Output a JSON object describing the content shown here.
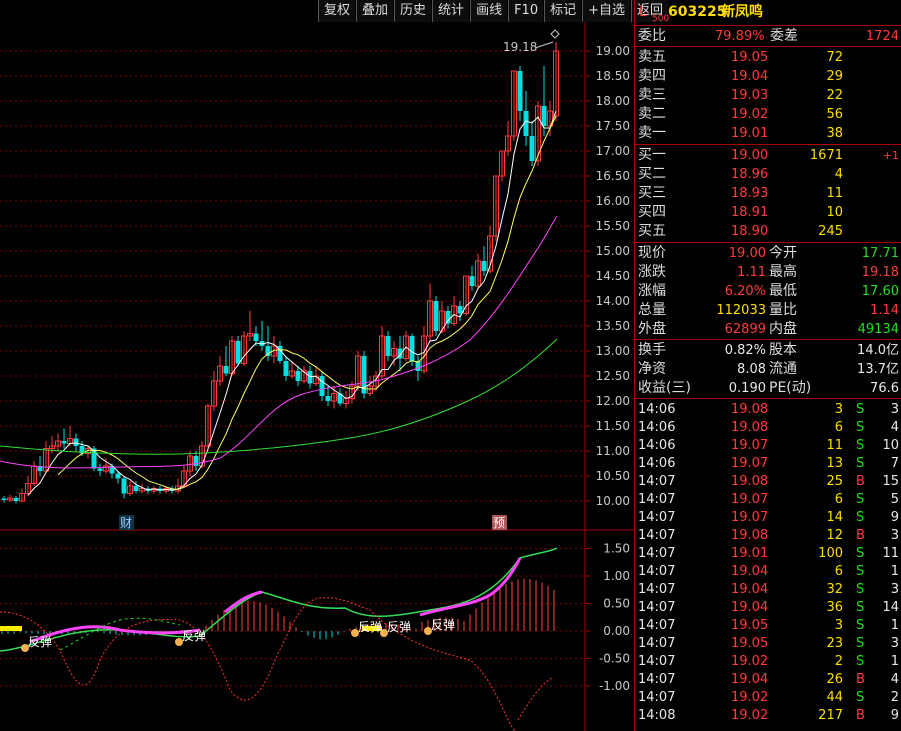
{
  "toolbar": [
    "复权",
    "叠加",
    "历史",
    "统计",
    "画线",
    "F10",
    "标记",
    "+自选",
    "返回"
  ],
  "stock": {
    "code_prefix": "L",
    "code_sub": "500",
    "code": "603225",
    "name": "新凤鸣"
  },
  "price_axis": [
    "19.00",
    "18.50",
    "18.00",
    "17.50",
    "17.00",
    "16.50",
    "16.00",
    "15.50",
    "15.00",
    "14.50",
    "14.00",
    "13.50",
    "13.00",
    "12.50",
    "12.00",
    "11.50",
    "11.00",
    "10.50",
    "10.00"
  ],
  "macd_axis": [
    "1.50",
    "1.00",
    "0.50",
    "0.00",
    "-0.50",
    "-1.00"
  ],
  "high_label": "19.18",
  "markers": {
    "cai": "财",
    "yu": "预"
  },
  "signal_label": "反弹",
  "weibi": {
    "label1": "委比",
    "val1": "79.89%",
    "label2": "委差",
    "val2": "1724"
  },
  "asks": [
    {
      "label": "卖五",
      "price": "19.05",
      "vol": "72"
    },
    {
      "label": "卖四",
      "price": "19.04",
      "vol": "29"
    },
    {
      "label": "卖三",
      "price": "19.03",
      "vol": "22"
    },
    {
      "label": "卖二",
      "price": "19.02",
      "vol": "56"
    },
    {
      "label": "卖一",
      "price": "19.01",
      "vol": "38"
    }
  ],
  "bids": [
    {
      "label": "买一",
      "price": "19.00",
      "vol": "1671",
      "chg": "+1"
    },
    {
      "label": "买二",
      "price": "18.96",
      "vol": "4",
      "chg": ""
    },
    {
      "label": "买三",
      "price": "18.93",
      "vol": "11",
      "chg": ""
    },
    {
      "label": "买四",
      "price": "18.91",
      "vol": "10",
      "chg": ""
    },
    {
      "label": "买五",
      "price": "18.90",
      "vol": "245",
      "chg": ""
    }
  ],
  "quote": [
    {
      "l1": "现价",
      "v1": "19.00",
      "c1": "red",
      "l2": "今开",
      "v2": "17.71",
      "c2": "grn"
    },
    {
      "l1": "涨跌",
      "v1": "1.11",
      "c1": "red",
      "l2": "最高",
      "v2": "19.18",
      "c2": "red"
    },
    {
      "l1": "涨幅",
      "v1": "6.20%",
      "c1": "red",
      "l2": "最低",
      "v2": "17.60",
      "c2": "grn"
    },
    {
      "l1": "总量",
      "v1": "112033",
      "c1": "yel",
      "l2": "量比",
      "v2": "1.14",
      "c2": "red"
    },
    {
      "l1": "外盘",
      "v1": "62899",
      "c1": "red",
      "l2": "内盘",
      "v2": "49134",
      "c2": "grn"
    }
  ],
  "fund": [
    {
      "l1": "换手",
      "v1": "0.82%",
      "l2": "股本",
      "v2": "14.0亿"
    },
    {
      "l1": "净资",
      "v1": "8.08",
      "l2": "流通",
      "v2": "13.7亿"
    },
    {
      "l1": "收益(三)",
      "v1": "0.190",
      "l2": "PE(动)",
      "v2": "76.6"
    }
  ],
  "ticks": [
    {
      "t": "14:06",
      "p": "19.08",
      "v": "3",
      "bs": "S",
      "n": "3"
    },
    {
      "t": "14:06",
      "p": "19.08",
      "v": "6",
      "bs": "S",
      "n": "4"
    },
    {
      "t": "14:06",
      "p": "19.07",
      "v": "11",
      "bs": "S",
      "n": "10"
    },
    {
      "t": "14:06",
      "p": "19.07",
      "v": "13",
      "bs": "S",
      "n": "7"
    },
    {
      "t": "14:07",
      "p": "19.08",
      "v": "25",
      "bs": "B",
      "n": "15"
    },
    {
      "t": "14:07",
      "p": "19.07",
      "v": "6",
      "bs": "S",
      "n": "5"
    },
    {
      "t": "14:07",
      "p": "19.07",
      "v": "14",
      "bs": "S",
      "n": "9"
    },
    {
      "t": "14:07",
      "p": "19.08",
      "v": "12",
      "bs": "B",
      "n": "3"
    },
    {
      "t": "14:07",
      "p": "19.01",
      "v": "100",
      "bs": "S",
      "n": "11"
    },
    {
      "t": "14:07",
      "p": "19.04",
      "v": "6",
      "bs": "S",
      "n": "1"
    },
    {
      "t": "14:07",
      "p": "19.04",
      "v": "32",
      "bs": "S",
      "n": "3"
    },
    {
      "t": "14:07",
      "p": "19.04",
      "v": "36",
      "bs": "S",
      "n": "14"
    },
    {
      "t": "14:07",
      "p": "19.05",
      "v": "3",
      "bs": "S",
      "n": "1"
    },
    {
      "t": "14:07",
      "p": "19.05",
      "v": "23",
      "bs": "S",
      "n": "3"
    },
    {
      "t": "14:07",
      "p": "19.02",
      "v": "2",
      "bs": "S",
      "n": "1"
    },
    {
      "t": "14:07",
      "p": "19.04",
      "v": "26",
      "bs": "B",
      "n": "4"
    },
    {
      "t": "14:07",
      "p": "19.02",
      "v": "44",
      "bs": "S",
      "n": "2"
    },
    {
      "t": "14:08",
      "p": "19.02",
      "v": "217",
      "bs": "B",
      "n": "9"
    }
  ],
  "colors": {
    "up": "#ff3b3b",
    "down": "#00e0e0",
    "ma5": "#ffffff",
    "ma10": "#ffff66",
    "ma20": "#ff44ff",
    "ma60": "#33dd33"
  }
}
